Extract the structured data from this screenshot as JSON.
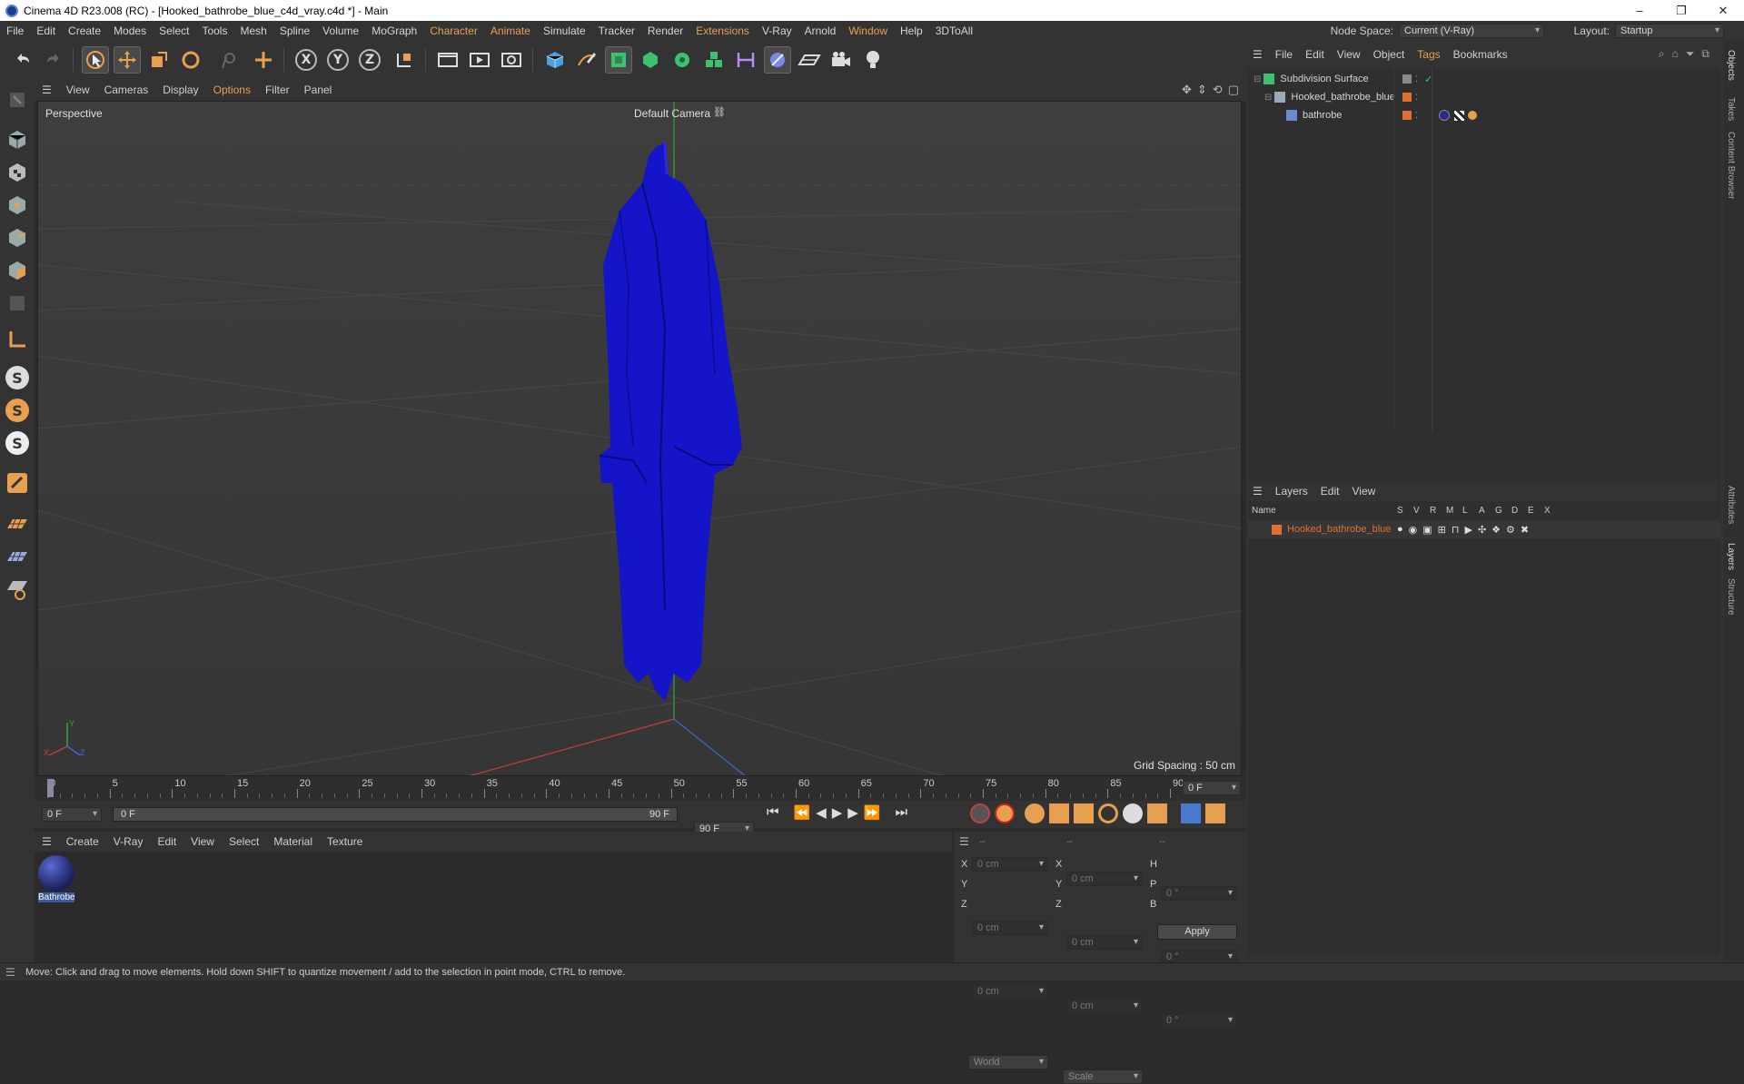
{
  "window": {
    "title": "Cinema 4D R23.008 (RC) - [Hooked_bathrobe_blue_c4d_vray.c4d *] - Main",
    "minimize": "–",
    "restore": "❐",
    "close": "✕"
  },
  "menubar": {
    "items": [
      "File",
      "Edit",
      "Create",
      "Modes",
      "Select",
      "Tools",
      "Mesh",
      "Spline",
      "Volume",
      "MoGraph",
      "Character",
      "Animate",
      "Simulate",
      "Tracker",
      "Render",
      "Extensions",
      "V-Ray",
      "Arnold",
      "Window",
      "Help",
      "3DToAll"
    ],
    "node_space_label": "Node Space:",
    "node_space_value": "Current (V-Ray)",
    "layout_label": "Layout:",
    "layout_value": "Startup"
  },
  "viewport": {
    "menu": [
      "View",
      "Cameras",
      "Display",
      "Options",
      "Filter",
      "Panel"
    ],
    "view_name": "Perspective",
    "camera_name": "Default Camera",
    "grid_spacing": "Grid Spacing : 50 cm",
    "axis_x": "X",
    "axis_y": "Y",
    "axis_z": "Z",
    "object_color": "#1414c8"
  },
  "timeline": {
    "ticks": [
      "0",
      "5",
      "10",
      "15",
      "20",
      "25",
      "30",
      "35",
      "40",
      "45",
      "50",
      "55",
      "60",
      "65",
      "70",
      "75",
      "80",
      "85",
      "90"
    ],
    "current_frame": "0 F",
    "start_frame": "0 F",
    "range_start": "0 F",
    "range_end": "90 F",
    "end_frame": "90 F"
  },
  "material_manager": {
    "menu": [
      "Create",
      "V-Ray",
      "Edit",
      "View",
      "Select",
      "Material",
      "Texture"
    ],
    "materials": [
      {
        "name": "Bathrobe"
      }
    ]
  },
  "coordinates": {
    "header_left": "--",
    "header_mid": "--",
    "header_right": "--",
    "rows": [
      {
        "a_label": "X",
        "a_val": "0 cm",
        "b_label": "X",
        "b_val": "0 cm",
        "c_label": "H",
        "c_val": "0 °"
      },
      {
        "a_label": "Y",
        "a_val": "0 cm",
        "b_label": "Y",
        "b_val": "0 cm",
        "c_label": "P",
        "c_val": "0 °"
      },
      {
        "a_label": "Z",
        "a_val": "0 cm",
        "b_label": "Z",
        "b_val": "0 cm",
        "c_label": "B",
        "c_val": "0 °"
      }
    ],
    "space": "World",
    "mode": "Scale",
    "apply": "Apply"
  },
  "object_manager": {
    "menu": [
      "File",
      "Edit",
      "View",
      "Object",
      "Tags",
      "Bookmarks"
    ],
    "objects": [
      {
        "name": "Subdivision Surface"
      },
      {
        "name": "Hooked_bathrobe_blue"
      },
      {
        "name": "bathrobe"
      }
    ]
  },
  "layer_manager": {
    "menu": [
      "Layers",
      "Edit",
      "View"
    ],
    "columns": [
      "Name",
      "S",
      "V",
      "R",
      "M",
      "L",
      "A",
      "G",
      "D",
      "E",
      "X"
    ],
    "layers": [
      {
        "name": "Hooked_bathrobe_blue",
        "color": "#e07030"
      }
    ]
  },
  "side_tabs": [
    "Objects",
    "Takes",
    "Content Browser",
    "Attributes",
    "Layers",
    "Structure"
  ],
  "status": {
    "text": "Move: Click and drag to move elements. Hold down SHIFT to quantize movement / add to the selection in point mode, CTRL to remove."
  },
  "colors": {
    "accent": "#e8a050",
    "layer_orange": "#e07030"
  }
}
